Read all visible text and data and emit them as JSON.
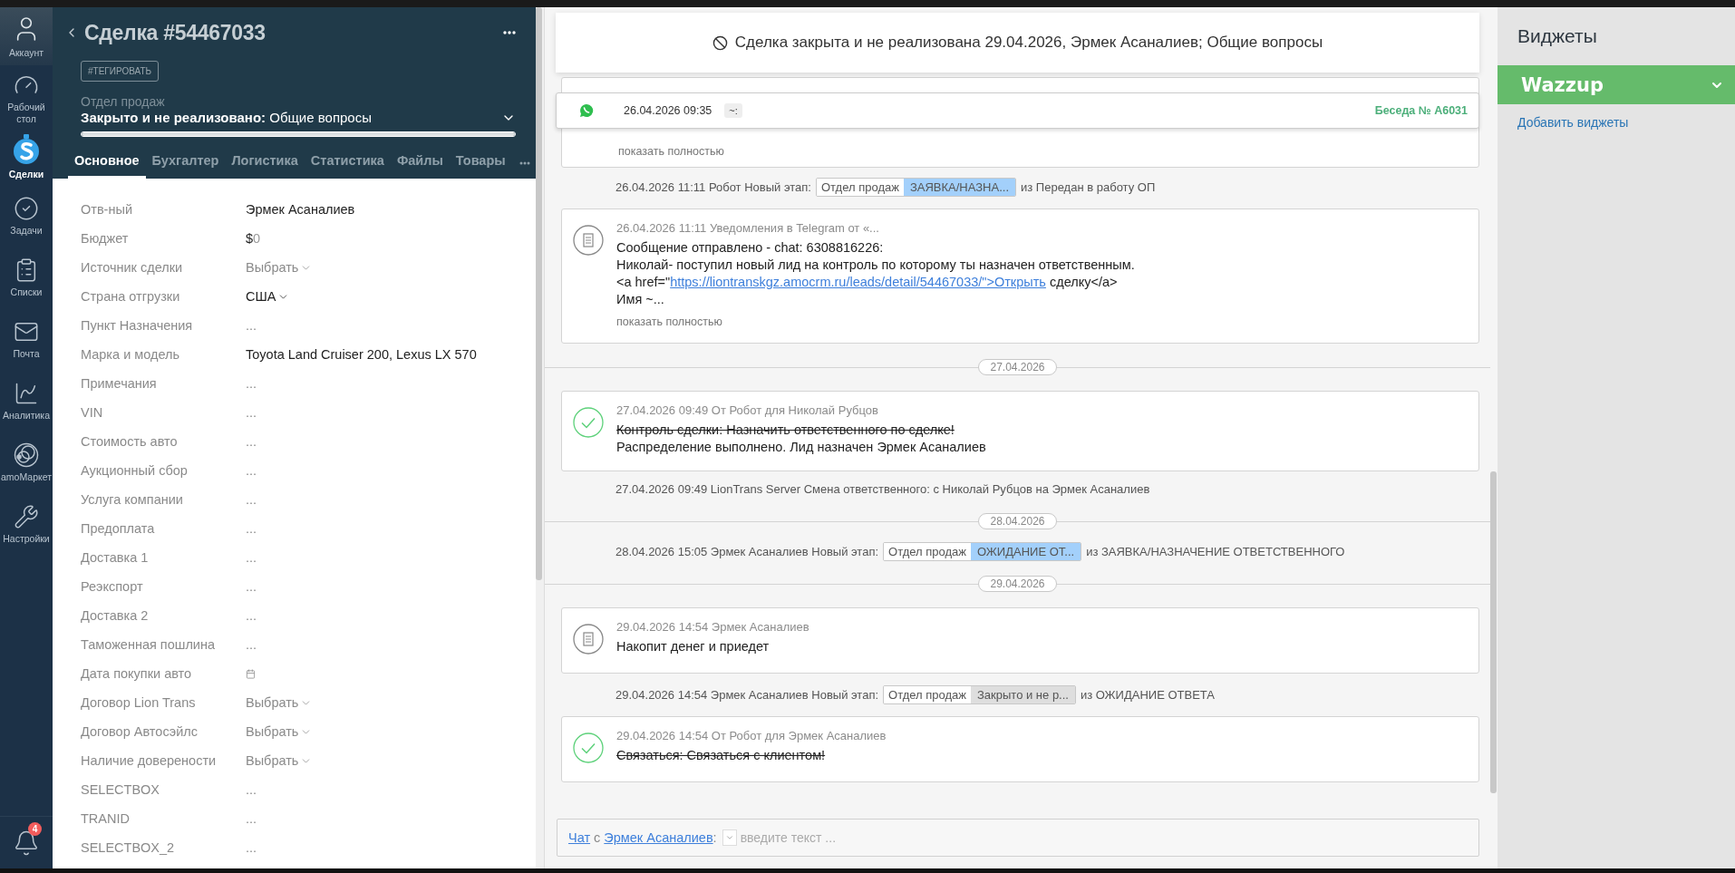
{
  "nav": {
    "items": [
      {
        "label": "Аккаунт",
        "selected": false
      },
      {
        "label": "Рабочий стол",
        "selected": false
      },
      {
        "label": "Сделки",
        "selected": true
      },
      {
        "label": "Задачи",
        "selected": false
      },
      {
        "label": "Списки",
        "selected": false
      },
      {
        "label": "Почта",
        "selected": false
      },
      {
        "label": "Аналитика",
        "selected": false
      },
      {
        "label": "amoМаркет",
        "selected": false
      },
      {
        "label": "Настройки",
        "selected": false
      }
    ],
    "notifications": {
      "badge": "4"
    }
  },
  "lead": {
    "title": "Сделка #54467033",
    "tag_button": "#ТЕГИРОВАТЬ",
    "pipeline": "Отдел продаж",
    "status": {
      "stage": "Закрыто и не реализовано:",
      "reason": "Общие вопросы",
      "level": 1
    },
    "tabs": [
      {
        "label": "Основное",
        "selected": true
      },
      {
        "label": "Бухгалтер",
        "selected": false
      },
      {
        "label": "Логистика",
        "selected": false
      },
      {
        "label": "Статистика",
        "selected": false
      },
      {
        "label": "Файлы",
        "selected": false
      },
      {
        "label": "Товары",
        "selected": false
      }
    ],
    "fields": [
      {
        "label": "Отв-ный",
        "kind": "text",
        "value": "Эрмек Асаналиев"
      },
      {
        "label": "Бюджет",
        "kind": "money",
        "currency": "$",
        "value": "0"
      },
      {
        "label": "Источник сделки",
        "kind": "select",
        "placeholder": "Выбрать"
      },
      {
        "label": "Страна отгрузки",
        "kind": "select",
        "value": "США"
      },
      {
        "label": "Пункт Назначения",
        "kind": "empty",
        "placeholder": "..."
      },
      {
        "label": "Марка и модель",
        "kind": "text",
        "value": "Toyota Land Cruiser 200, Lexus LX 570"
      },
      {
        "label": "Примечания",
        "kind": "empty",
        "placeholder": "..."
      },
      {
        "label": "VIN",
        "kind": "empty",
        "placeholder": "..."
      },
      {
        "label": "Стоимость авто",
        "kind": "empty",
        "placeholder": "..."
      },
      {
        "label": "Аукционный сбор",
        "kind": "empty",
        "placeholder": "..."
      },
      {
        "label": "Услуга компании",
        "kind": "empty",
        "placeholder": "..."
      },
      {
        "label": "Предоплата",
        "kind": "empty",
        "placeholder": "..."
      },
      {
        "label": "Доставка 1",
        "kind": "empty",
        "placeholder": "..."
      },
      {
        "label": "Реэкспорт",
        "kind": "empty",
        "placeholder": "..."
      },
      {
        "label": "Доставка 2",
        "kind": "empty",
        "placeholder": "..."
      },
      {
        "label": "Таможенная пошлина",
        "kind": "empty",
        "placeholder": "..."
      },
      {
        "label": "Дата покупки авто",
        "kind": "date"
      },
      {
        "label": "Договор Lion Trans",
        "kind": "select",
        "placeholder": "Выбрать"
      },
      {
        "label": "Договор Автосэйлс",
        "kind": "select",
        "placeholder": "Выбрать"
      },
      {
        "label": "Наличие доверености",
        "kind": "select",
        "placeholder": "Выбрать"
      },
      {
        "label": "SELECTBOX",
        "kind": "empty",
        "placeholder": "..."
      },
      {
        "label": "TRANID",
        "kind": "empty",
        "placeholder": "..."
      },
      {
        "label": "SELECTBOX_2",
        "kind": "empty",
        "placeholder": "..."
      }
    ]
  },
  "feed": {
    "banner": "Сделка закрыта и не реализована 29.04.2026, Эрмек Асаналиев; Общие вопросы",
    "chat_bar": {
      "time": "26.04.2026 09:35",
      "tag": "~:",
      "conversation": "Беседа № A6031"
    },
    "items": [
      {
        "kind": "partial",
        "more": "показать полностью"
      },
      {
        "kind": "stage",
        "text": "26.04.2026 11:11 Робот Новый этап:",
        "pipeline": "Отдел продаж",
        "stage": "ЗАЯВКА/НАЗНА...",
        "color": "#a3d0fb",
        "from": "из Передан в работу ОП"
      },
      {
        "kind": "note",
        "header": "26.04.2026 11:11 Уведомления в Telegram от «...",
        "lines": [
          {
            "text": "Сообщение отправлено - chat: 6308816226:"
          },
          {
            "text": "Николай- поступил новый лид на контроль по которому ты назначен ответственным."
          },
          {
            "text": "<a href=\"",
            "link": "https://liontranskgz.amocrm.ru/leads/detail/54467033/\">Открыть",
            "after": " сделку</a>"
          },
          {
            "text": "Имя ~..."
          }
        ],
        "more": "показать полностью"
      },
      {
        "kind": "date",
        "text": "27.04.2026"
      },
      {
        "kind": "task",
        "header": "27.04.2026 09:49  От Робот для Николай Рубцов",
        "lines": [
          {
            "text": "Контроль сделки: Назначить ответственного по сделке!",
            "struck": true
          },
          {
            "text": "Распределение выполнено. Лид назначен Эрмек Асаналиев",
            "struck": false
          }
        ]
      },
      {
        "kind": "system",
        "text": "27.04.2026 09:49 LionTrans Server Смена ответственного: с Николай Рубцов на Эрмек Асаналиев"
      },
      {
        "kind": "date",
        "text": "28.04.2026"
      },
      {
        "kind": "stage",
        "text": "28.04.2026 15:05 Эрмек Асаналиев Новый этап:",
        "pipeline": "Отдел продаж",
        "stage": "ОЖИДАНИЕ ОТ...",
        "color": "#a3d0fb",
        "from": "из ЗАЯВКА/НАЗНАЧЕНИЕ ОТВЕТСТВЕННОГО"
      },
      {
        "kind": "date",
        "text": "29.04.2026"
      },
      {
        "kind": "note",
        "header": "29.04.2026 14:54 Эрмек Асаналиев",
        "lines": [
          {
            "text": "Накопит денег и приедет"
          }
        ]
      },
      {
        "kind": "stage",
        "text": "29.04.2026 14:54 Эрмек Асаналиев Новый этап:",
        "pipeline": "Отдел продаж",
        "stage": "Закрыто и не р...",
        "color": "#dedede",
        "from": "из ОЖИДАНИЕ ОТВЕТА"
      },
      {
        "kind": "task",
        "header": "29.04.2026 14:54  От Робот для Эрмек Асаналиев",
        "lines": [
          {
            "text": "Связаться: Связаться с клиентом!",
            "struck": true
          }
        ]
      }
    ],
    "composer": {
      "chat_link": "Чат",
      "conjunction": "с",
      "contact": "Эрмек Асаналиев",
      "separator": ":",
      "placeholder": "введите текст ..."
    }
  },
  "widgets": {
    "title": "Виджеты",
    "items": [
      {
        "name": "Wazzup"
      }
    ],
    "add_link": "Добавить виджеты"
  }
}
